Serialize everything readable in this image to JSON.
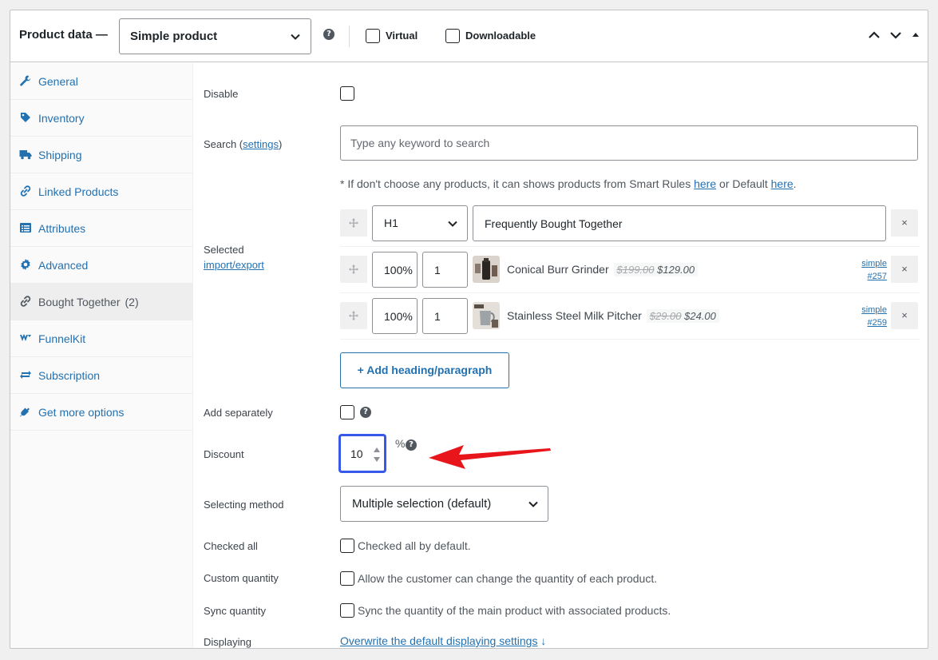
{
  "header": {
    "title": "Product data —",
    "product_type": "Simple product",
    "virtual_label": "Virtual",
    "downloadable_label": "Downloadable",
    "help_glyph": "?"
  },
  "sidebar": {
    "items": [
      {
        "label": "General",
        "icon": "wrench-icon"
      },
      {
        "label": "Inventory",
        "icon": "tag-icon"
      },
      {
        "label": "Shipping",
        "icon": "truck-icon"
      },
      {
        "label": "Linked Products",
        "icon": "link-icon"
      },
      {
        "label": "Attributes",
        "icon": "list-icon"
      },
      {
        "label": "Advanced",
        "icon": "gear-icon"
      },
      {
        "label": "Bought Together",
        "count": "(2)",
        "icon": "link-icon",
        "active": true
      },
      {
        "label": "FunnelKit",
        "icon": "funnelkit-icon"
      },
      {
        "label": "Subscription",
        "icon": "repeat-icon"
      },
      {
        "label": "Get more options",
        "icon": "plug-icon"
      }
    ]
  },
  "main": {
    "disable_label": "Disable",
    "search": {
      "label_prefix": "Search (",
      "label_link": "settings",
      "label_suffix": ")",
      "placeholder": "Type any keyword to search"
    },
    "note": {
      "text1": "* If don't choose any products, it can shows products from Smart Rules ",
      "link1": "here",
      "text2": " or Default ",
      "link2": "here",
      "text3": "."
    },
    "selected": {
      "label": "Selected",
      "link": "import/export"
    },
    "heading_row": {
      "tag": "H1",
      "text": "Frequently Bought Together",
      "remove": "×"
    },
    "products": [
      {
        "percent": "100%",
        "qty": "1",
        "name": "Conical Burr Grinder",
        "old_price": "$199.00",
        "price": "$129.00",
        "type": "simple",
        "id": "#257",
        "remove": "×"
      },
      {
        "percent": "100%",
        "qty": "1",
        "name": "Stainless Steel Milk Pitcher",
        "old_price": "$29.00",
        "price": "$24.00",
        "type": "simple",
        "id": "#259",
        "remove": "×"
      }
    ],
    "add_heading_button": "+ Add heading/paragraph",
    "add_separately_label": "Add separately",
    "discount": {
      "label": "Discount",
      "value": "10",
      "unit": "%"
    },
    "selecting_method": {
      "label": "Selecting method",
      "value": "Multiple selection (default)"
    },
    "checked_all": {
      "label": "Checked all",
      "text": "Checked all by default."
    },
    "custom_quantity": {
      "label": "Custom quantity",
      "text": "Allow the customer can change the quantity of each product."
    },
    "sync_quantity": {
      "label": "Sync quantity",
      "text": "Sync the quantity of the main product with associated products."
    },
    "displaying": {
      "label": "Displaying",
      "link": "Overwrite the default displaying settings",
      "arrow": "↓"
    }
  },
  "colors": {
    "link": "#2271b1",
    "focus": "#3858e9",
    "annotation_arrow": "#e8151b"
  }
}
